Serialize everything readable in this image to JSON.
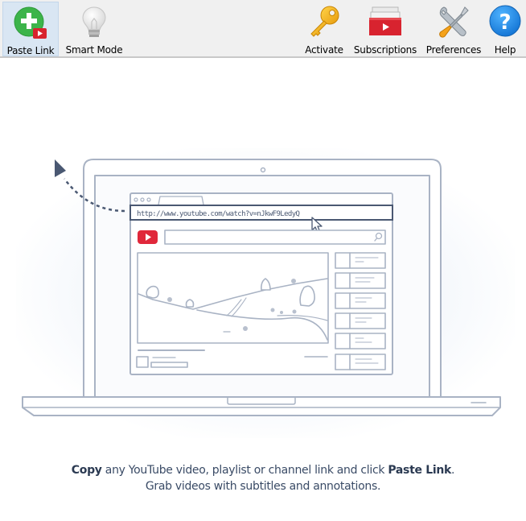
{
  "toolbar": {
    "buttons": [
      {
        "id": "paste-link",
        "label": "Paste Link",
        "icon": "plus-youtube-icon",
        "active": true
      },
      {
        "id": "smart-mode",
        "label": "Smart Mode",
        "icon": "lightbulb-icon",
        "active": false
      },
      {
        "id": "activate",
        "label": "Activate",
        "icon": "key-icon",
        "active": false
      },
      {
        "id": "subscriptions",
        "label": "Subscriptions",
        "icon": "subscriptions-icon",
        "active": false
      },
      {
        "id": "preferences",
        "label": "Preferences",
        "icon": "tools-icon",
        "active": false
      },
      {
        "id": "help",
        "label": "Help",
        "icon": "help-icon",
        "active": false
      }
    ]
  },
  "illustration": {
    "url_text": "http://www.youtube.com/watch?v=nJkwF9LedyQ"
  },
  "caption": {
    "line1_bold_start": "Copy",
    "line1_middle": " any YouTube video, playlist or channel link and click ",
    "line1_bold_end": "Paste Link",
    "line1_end": ".",
    "line2": "Grab videos with subtitles and annotations."
  },
  "colors": {
    "accent_green": "#3cb44a",
    "youtube_red": "#e0283b",
    "help_blue": "#1e8fe6",
    "key_gold": "#f2b21b",
    "sketch_gray": "#a9b3c4",
    "sketch_dark": "#4a5872"
  }
}
